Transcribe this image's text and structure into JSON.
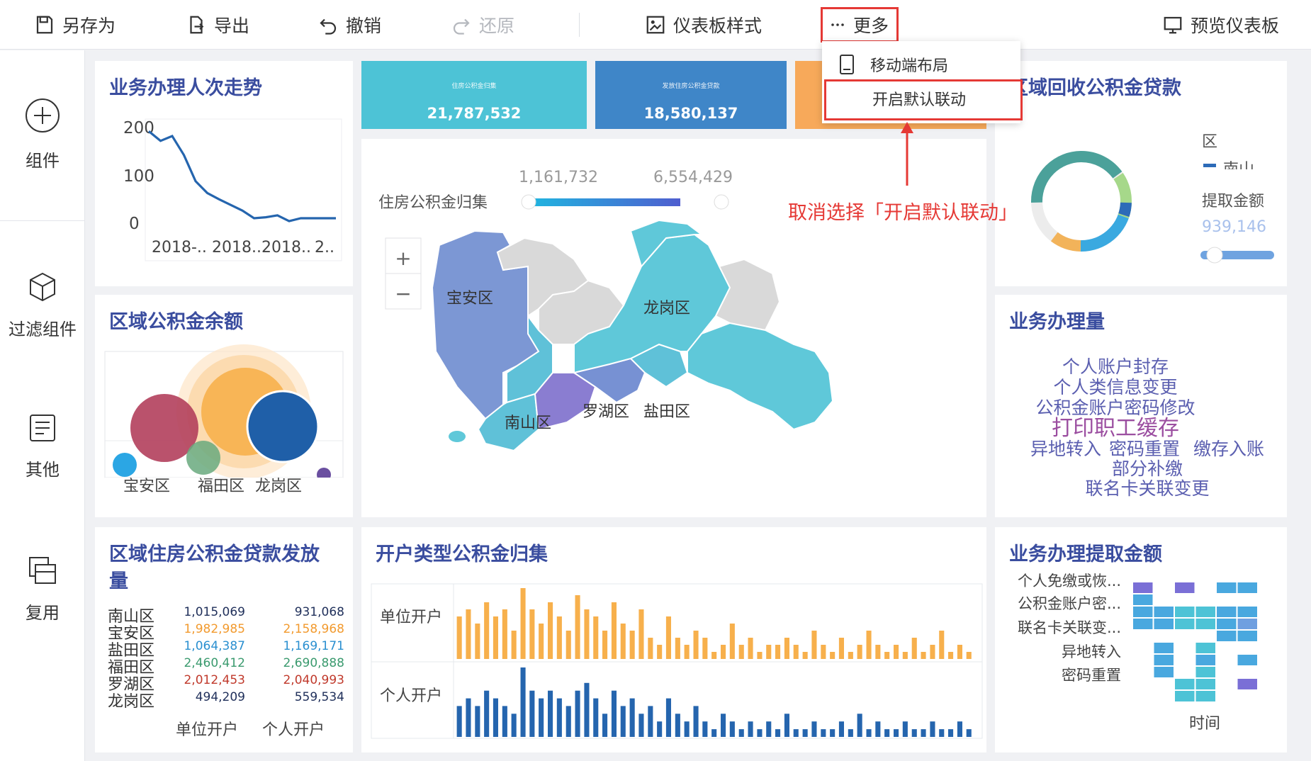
{
  "toolbar": {
    "save_as": "另存为",
    "export": "导出",
    "undo": "撤销",
    "redo": "还原",
    "dashboard_style": "仪表板样式",
    "more": "更多",
    "preview": "预览仪表板"
  },
  "sidebar": {
    "items": [
      {
        "label": "组件",
        "icon": "plus-circle-icon"
      },
      {
        "label": "过滤组件",
        "icon": "cube-icon"
      },
      {
        "label": "其他",
        "icon": "document-icon"
      },
      {
        "label": "复用",
        "icon": "copy-icon"
      }
    ]
  },
  "dropdown": {
    "items": [
      {
        "label": "移动端布局",
        "icon": "mobile-icon"
      },
      {
        "label": "开启默认联动"
      }
    ]
  },
  "annotation": "取消选择「开启默认联动」",
  "kpis": [
    {
      "label": "住房公积金归集",
      "value": "21,787,532",
      "color": "#4dc3d6"
    },
    {
      "label": "发放住房公积金贷款",
      "value": "18,580,137",
      "color": "#3f86c8"
    },
    {
      "label": "",
      "value": "",
      "color": "#f7a95a"
    }
  ],
  "cards": {
    "trend": {
      "title": "业务办理人次走势"
    },
    "balance": {
      "title": "区域公积金余额"
    },
    "recovery": {
      "title": "区域回收公积金贷款",
      "legend_title": "区",
      "legend_item": "南山",
      "measure_label": "提取金额",
      "measure_value": "939,146"
    },
    "volume": {
      "title": "业务办理量"
    },
    "loan": {
      "title": "区域住房公积金贷款发放量"
    },
    "account_type": {
      "title": "开户类型公积金归集"
    },
    "withdraw": {
      "title": "业务办理提取金额"
    }
  },
  "map": {
    "legend_label": "住房公积金归集",
    "range_min": "1,161,732",
    "range_max": "6,554,429",
    "zoom_in": "+",
    "zoom_out": "−",
    "districts": [
      "宝安区",
      "龙岗区",
      "南山区",
      "罗湖区",
      "盐田区"
    ]
  },
  "wordcloud": {
    "words": [
      {
        "text": "个人账户封存",
        "color": "#5b5fb0"
      },
      {
        "text": "个人类信息变更",
        "color": "#5b5fb0"
      },
      {
        "text": "公积金账户密码修改",
        "color": "#5b5fb0"
      },
      {
        "text": "打印职工缓存",
        "color": "#9b4ea0"
      },
      {
        "text": "异地转入",
        "color": "#5b5fb0"
      },
      {
        "text": "密码重置",
        "color": "#5b5fb0"
      },
      {
        "text": "缴存入账",
        "color": "#5b5fb0"
      },
      {
        "text": "部分补缴",
        "color": "#5b5fb0"
      },
      {
        "text": "联名卡关联变更",
        "color": "#5b5fb0"
      }
    ]
  },
  "loan_table": {
    "rows": [
      {
        "district": "南山区",
        "unit": "1,015,069",
        "personal": "931,068",
        "color": "#1f2f5a"
      },
      {
        "district": "宝安区",
        "unit": "1,982,985",
        "personal": "2,158,968",
        "color": "#f29a2e"
      },
      {
        "district": "盐田区",
        "unit": "1,064,387",
        "personal": "1,169,171",
        "color": "#2a8fd0"
      },
      {
        "district": "福田区",
        "unit": "2,460,412",
        "personal": "2,690,888",
        "color": "#3a9a6e"
      },
      {
        "district": "罗湖区",
        "unit": "2,012,453",
        "personal": "2,040,993",
        "color": "#c0392b"
      },
      {
        "district": "龙岗区",
        "unit": "494,209",
        "personal": "559,534",
        "color": "#1f2f5a"
      }
    ],
    "col_unit": "单位开户",
    "col_personal": "个人开户"
  },
  "heatmap": {
    "rows": [
      "个人免缴或恢...",
      "公积金账户密...",
      "联名卡关联变...",
      "异地转入",
      "密码重置"
    ],
    "xlabel": "时间"
  },
  "chart_data": [
    {
      "type": "line",
      "title": "业务办理人次走势",
      "x": [
        "2018-..",
        "2018..",
        "2018..",
        "2.."
      ],
      "y": [
        195,
        175,
        185,
        145,
        90,
        65,
        52,
        40,
        28,
        12,
        14,
        18,
        6,
        12,
        12,
        12,
        12
      ],
      "yticks": [
        0,
        100,
        200
      ],
      "ylim": [
        0,
        200
      ]
    },
    {
      "type": "scatter",
      "title": "区域公积金余额",
      "categories": [
        "宝安区",
        "福田区",
        "龙岗区"
      ]
    },
    {
      "type": "pie",
      "title": "区域回收公积金贷款"
    },
    {
      "type": "bar",
      "title": "开户类型公积金归集",
      "series": [
        {
          "name": "单位开户",
          "values": [
            6,
            7,
            5,
            8,
            6,
            7,
            4,
            10,
            7,
            5,
            8,
            6,
            4,
            9,
            7,
            6,
            4,
            8,
            5,
            4,
            7,
            3,
            2,
            6,
            3,
            2,
            4,
            3,
            1,
            2,
            5,
            2,
            3,
            1,
            2,
            2,
            3,
            2,
            1,
            4,
            2,
            1,
            3,
            1,
            2,
            4,
            2,
            1,
            2,
            1,
            3,
            1,
            2,
            4,
            1,
            2,
            1
          ]
        },
        {
          "name": "个人开户",
          "values": [
            4,
            5,
            4,
            6,
            5,
            4,
            3,
            9,
            6,
            5,
            6,
            5,
            4,
            6,
            7,
            5,
            3,
            6,
            4,
            5,
            3,
            4,
            2,
            5,
            3,
            2,
            4,
            2,
            1,
            3,
            2,
            1,
            2,
            1,
            2,
            1,
            3,
            1,
            1,
            2,
            1,
            1,
            2,
            1,
            3,
            1,
            2,
            1,
            1,
            2,
            1,
            1,
            2,
            1,
            1,
            2,
            1
          ]
        }
      ]
    }
  ]
}
